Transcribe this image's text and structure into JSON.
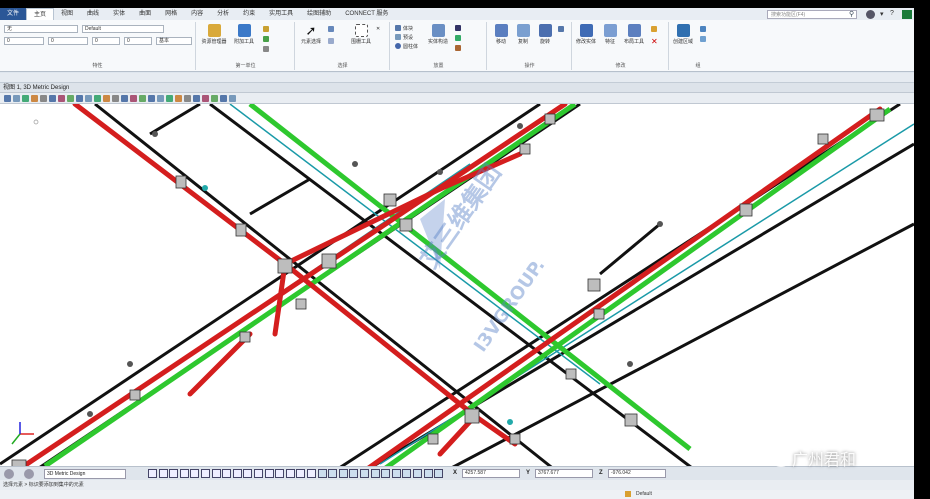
{
  "menu": {
    "tabs": [
      "文件",
      "主页",
      "视图",
      "曲线",
      "实体",
      "曲面",
      "网格",
      "内容",
      "分析",
      "约束",
      "实用工具",
      "绘图辅助",
      "CONNECT 服务"
    ],
    "active_index": 1,
    "search_placeholder": "搜索功能区(F4)"
  },
  "ribbon": {
    "attr_level": "无",
    "attr_style": "Default",
    "attr_color": "0",
    "attr_weight": "0",
    "attr_weight2": "0",
    "attr_base": "基本",
    "groups": [
      {
        "label": "特性"
      },
      {
        "label": "第一单位"
      },
      {
        "label": "选择"
      },
      {
        "label": "放置"
      },
      {
        "label": "操作"
      },
      {
        "label": "修改"
      },
      {
        "label": "组"
      }
    ],
    "buttons": {
      "resource_manager": "资源管理器",
      "attach_tools": "附加工具",
      "element_selection": "元素选择",
      "fence_tools": "围栅工具",
      "solid": "体块",
      "pre_model": "预设",
      "place_solid": "圆柱体",
      "solid_construct": "实体构造",
      "move": "移动",
      "copy": "复制",
      "rotate": "旋转",
      "modify_solid": "修改实体",
      "feature": "特征",
      "layout_tools": "布局工具",
      "create_region": "创建区域"
    }
  },
  "view": {
    "title": "视图 1, 3D Metric Design"
  },
  "watermark": {
    "line1": "艾三维集团",
    "line2": "I3VGROUP."
  },
  "bottom": {
    "view_name": "3D Metric Design",
    "x_label": "X",
    "x_value": "4257.587",
    "y_label": "Y",
    "y_value": "3767.677",
    "z_label": "Z",
    "z_value": "-976.042"
  },
  "status": {
    "prompt": "选择元素 > 标识要添加到集中的元素",
    "level": "Default"
  },
  "overlay": {
    "wechat_text": "广州君和"
  },
  "colors": {
    "red_pipe": "#d41e1e",
    "green_pipe": "#2ec82e",
    "black_pipe": "#111111",
    "cyan_pipe": "#1a9aa8",
    "accent": "#2b5797"
  }
}
